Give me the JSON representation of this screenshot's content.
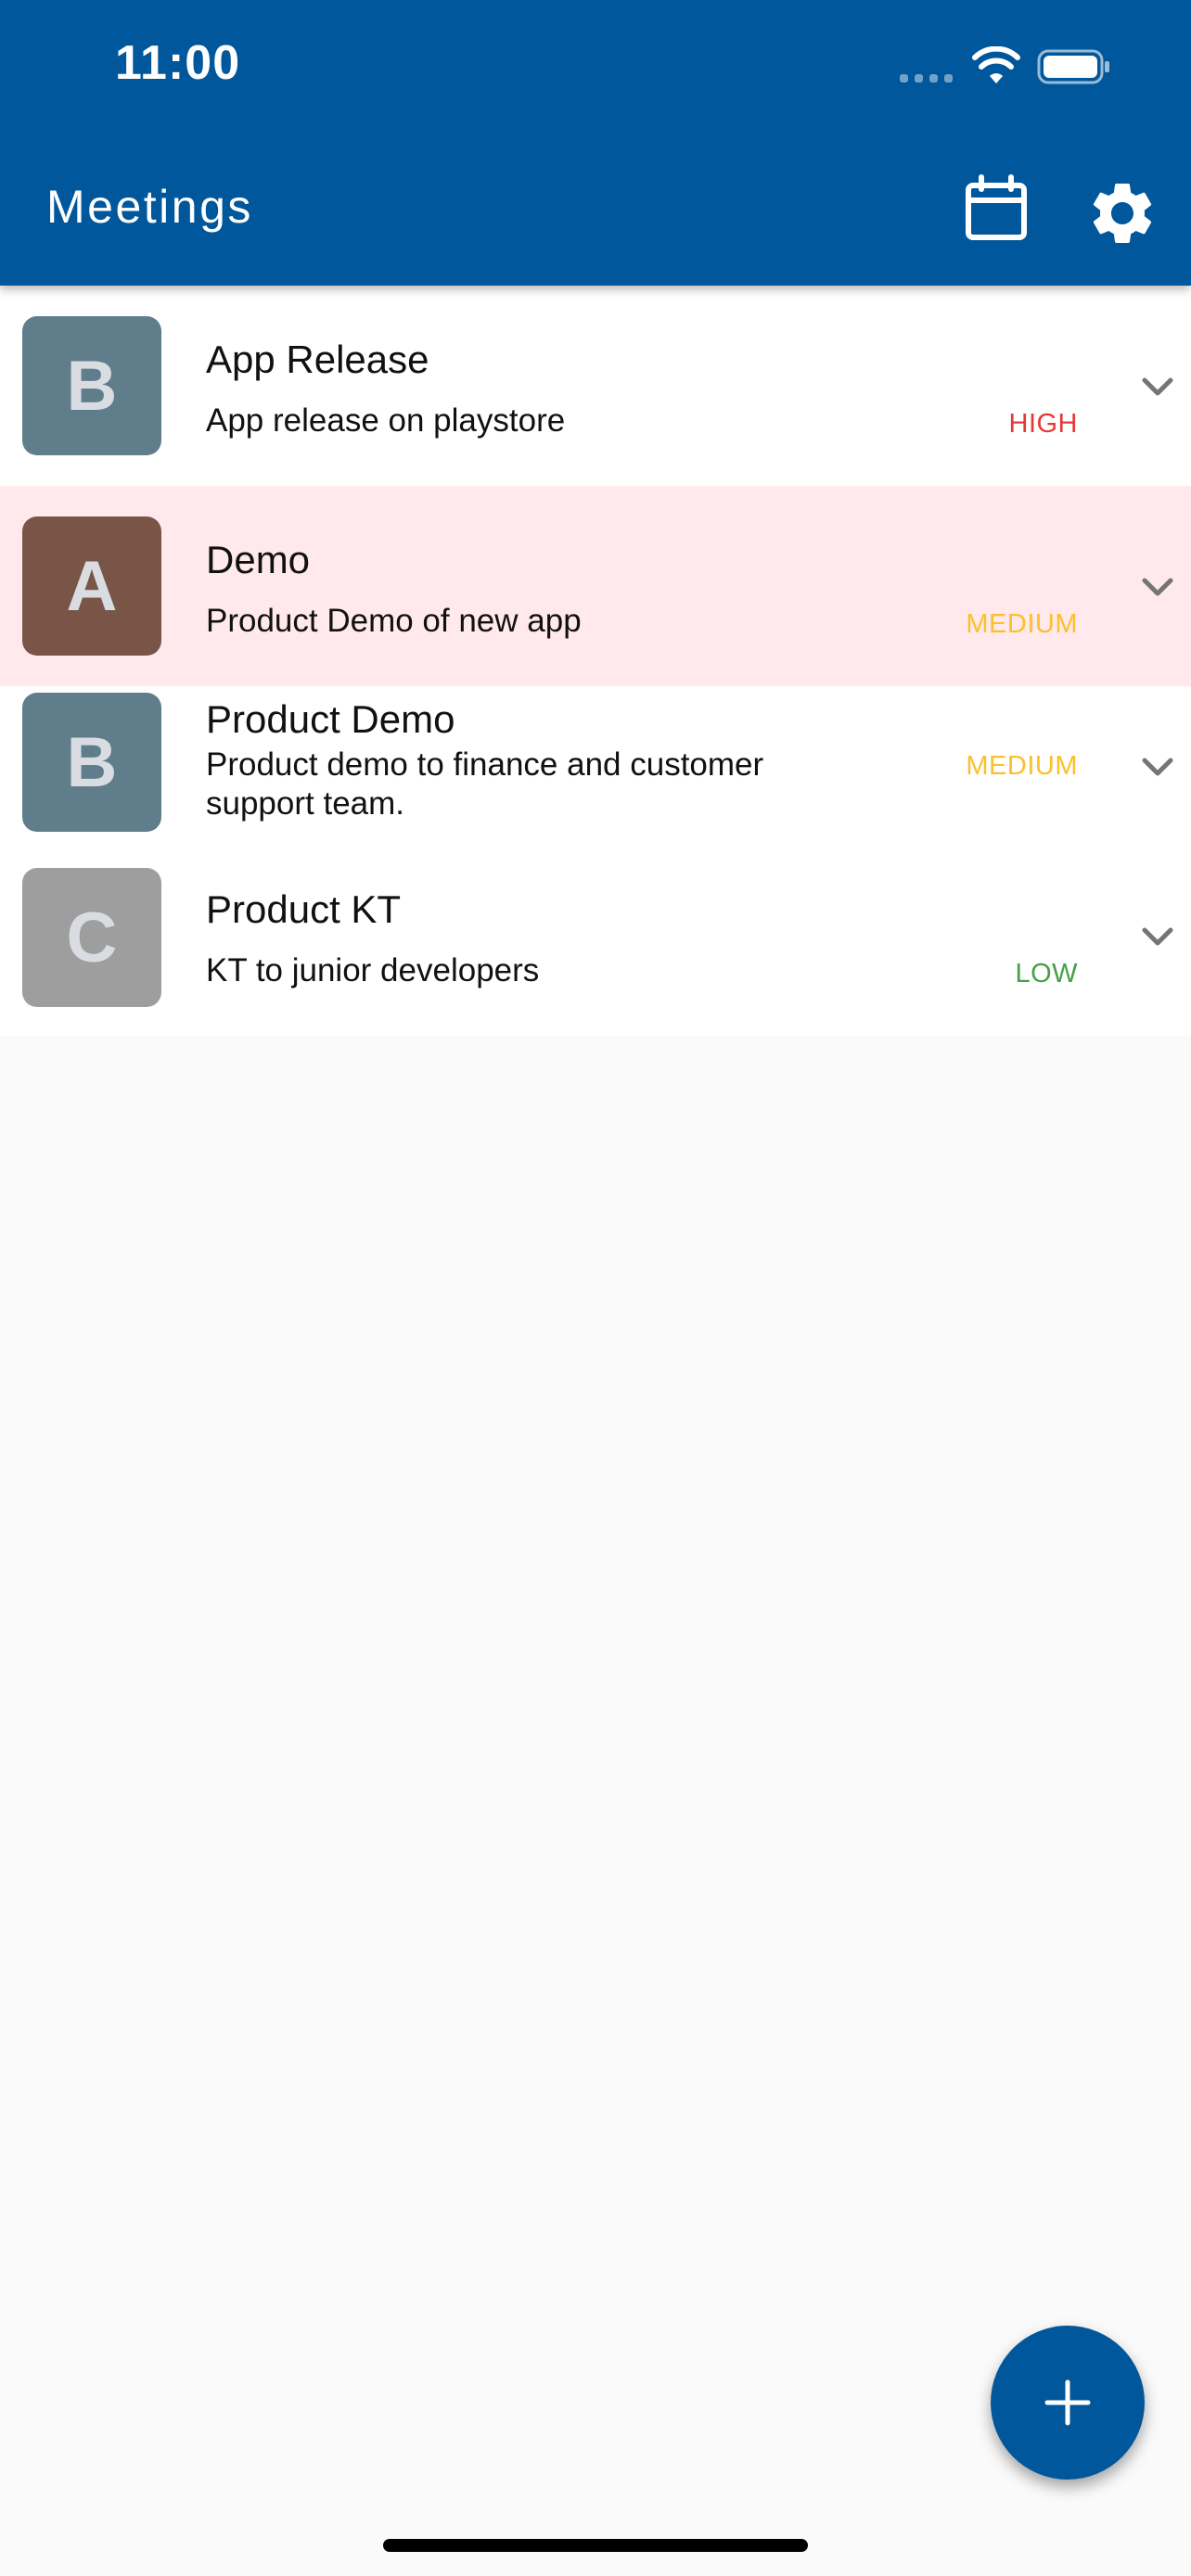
{
  "status_bar": {
    "time": "11:00"
  },
  "appbar": {
    "title": "Meetings",
    "calendar_icon": "calendar-icon",
    "settings_icon": "gear-icon",
    "background_color": "#01579b"
  },
  "meetings": [
    {
      "avatar_letter": "B",
      "avatar_color": "#607d8b",
      "title": "App Release",
      "description": "App release on playstore",
      "priority": "HIGH",
      "priority_color": "#e53935",
      "selected": false
    },
    {
      "avatar_letter": "A",
      "avatar_color": "#795548",
      "title": "Demo",
      "description": "Product Demo of new app",
      "priority": "MEDIUM",
      "priority_color": "#fbc02d",
      "selected": true
    },
    {
      "avatar_letter": "B",
      "avatar_color": "#607d8b",
      "title": "Product Demo",
      "description": "Product demo to finance and customer support team.",
      "priority": "MEDIUM",
      "priority_color": "#fbc02d",
      "selected": false
    },
    {
      "avatar_letter": "C",
      "avatar_color": "#9e9e9e",
      "title": "Product KT",
      "description": "KT to junior developers",
      "priority": "LOW",
      "priority_color": "#43a047",
      "selected": false
    }
  ],
  "fab": {
    "icon": "plus-icon"
  }
}
